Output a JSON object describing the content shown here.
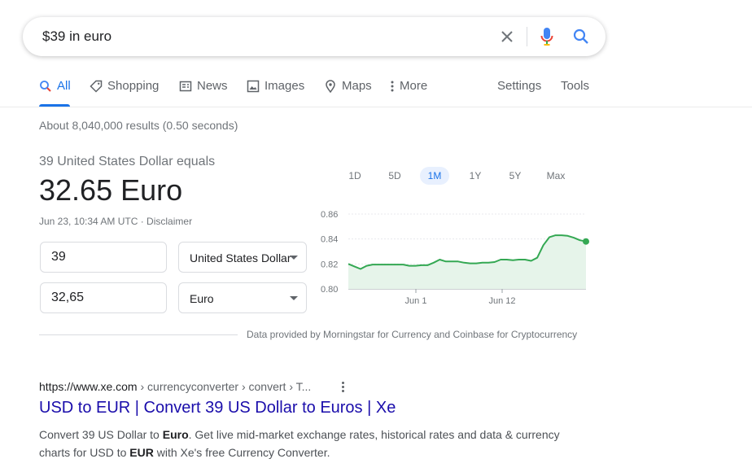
{
  "search": {
    "query": "$39 in euro"
  },
  "tabs": [
    {
      "label": "All",
      "icon": "search-icon",
      "active": true
    },
    {
      "label": "Shopping",
      "icon": "tag-icon"
    },
    {
      "label": "News",
      "icon": "news-icon"
    },
    {
      "label": "Images",
      "icon": "image-icon"
    },
    {
      "label": "Maps",
      "icon": "map-pin-icon"
    },
    {
      "label": "More",
      "icon": "more-vert-icon"
    }
  ],
  "tools": {
    "settings": "Settings",
    "tools": "Tools"
  },
  "result_stats": "About 8,040,000 results (0.50 seconds)",
  "converter": {
    "equals_label": "39 United States Dollar equals",
    "value": "32.65 Euro",
    "meta": "Jun 23, 10:34 AM UTC · Disclaimer",
    "from_amount": "39",
    "from_currency": "United States Dollar",
    "to_amount": "32,65",
    "to_currency": "Euro",
    "attribution": "Data provided by Morningstar for Currency and Coinbase for Cryptocurrency"
  },
  "range_buttons": [
    "1D",
    "5D",
    "1M",
    "1Y",
    "5Y",
    "Max"
  ],
  "chart_data": {
    "type": "area",
    "ylim": [
      0.8,
      0.86
    ],
    "yticks": [
      "0.86",
      "0.84",
      "0.82",
      "0.80"
    ],
    "xticks": [
      "Jun 1",
      "Jun 12"
    ],
    "series": [
      {
        "values": [
          0.82,
          0.818,
          0.816,
          0.8185,
          0.8195,
          0.8195,
          0.8195,
          0.8195,
          0.8195,
          0.8195,
          0.8185,
          0.8185,
          0.819,
          0.819,
          0.821,
          0.8235,
          0.822,
          0.822,
          0.822,
          0.821,
          0.8205,
          0.8205,
          0.821,
          0.821,
          0.8215,
          0.8235,
          0.8235,
          0.823,
          0.8235,
          0.8235,
          0.8225,
          0.825,
          0.835,
          0.8415,
          0.843,
          0.843,
          0.8425,
          0.841,
          0.839,
          0.838
        ]
      }
    ],
    "colors": {
      "line": "#34a853",
      "fill": "#e6f4ea"
    }
  },
  "result": {
    "url_domain": "https://www.xe.com",
    "url_crumbs": " › currencyconverter › convert › T...",
    "title": "USD to EUR | Convert 39 US Dollar to Euros | Xe",
    "snippet_1": "Convert 39 US Dollar to ",
    "snippet_b1": "Euro",
    "snippet_2": ". Get live mid-market exchange rates, historical rates and data & currency charts for USD to ",
    "snippet_b2": "EUR",
    "snippet_3": " with Xe's free Currency Converter."
  }
}
